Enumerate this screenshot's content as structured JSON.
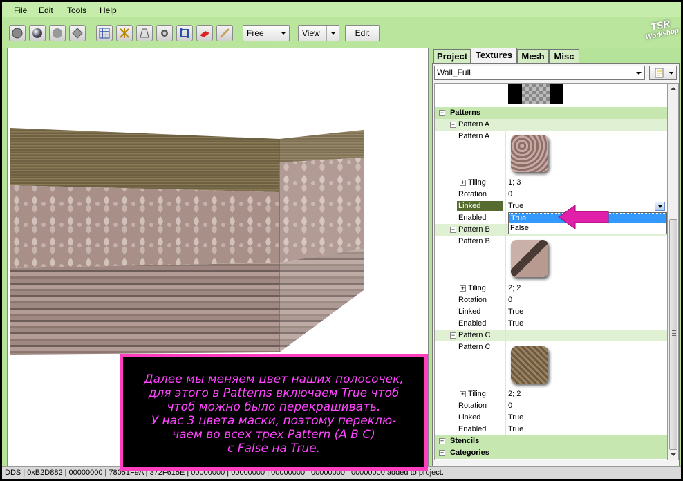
{
  "menu": [
    "File",
    "Edit",
    "Tools",
    "Help"
  ],
  "toolbar": {
    "mode_combo": "Free",
    "view_combo": "View",
    "edit_button": "Edit"
  },
  "logo": {
    "line1": "TSR",
    "line2": "Workshop"
  },
  "tabs": [
    "Project",
    "Textures",
    "Mesh",
    "Misc"
  ],
  "active_tab": "Textures",
  "texture_select": "Wall_Full",
  "properties": {
    "patterns": "Patterns",
    "pattern_a": {
      "header": "Pattern A",
      "image_label": "Pattern A",
      "tiling_label": "Tiling",
      "tiling": "1; 3",
      "rotation_label": "Rotation",
      "rotation": "0",
      "linked_label": "Linked",
      "linked": "True",
      "enabled_label": "Enabled"
    },
    "pattern_b": {
      "header": "Pattern B",
      "image_label": "Pattern B",
      "tiling_label": "Tiling",
      "tiling": "2; 2",
      "rotation_label": "Rotation",
      "rotation": "0",
      "linked_label": "Linked",
      "linked": "True",
      "enabled_label": "Enabled",
      "enabled": "True"
    },
    "pattern_c": {
      "header": "Pattern C",
      "image_label": "Pattern C",
      "tiling_label": "Tiling",
      "tiling": "2; 2",
      "rotation_label": "Rotation",
      "rotation": "0",
      "linked_label": "Linked",
      "linked": "True",
      "enabled_label": "Enabled",
      "enabled": "True"
    },
    "stencils": "Stencils",
    "categories": "Categories"
  },
  "dropdown_options": [
    "True",
    "False"
  ],
  "dropdown_selected": "True",
  "overlay_lines": [
    "Далее мы меняем цвет наших полосочек,",
    "для этого в Patterns включаем True чтоб",
    "чтоб можно было перекрашивать.",
    "У нас 3 цвета маски, поэтому переклю-",
    "чаем во всех трех Pattern (A B C)",
    "с False на True."
  ],
  "statusbar": "DDS | 0xB2D882 | 00000000 | 78051F9A | 372F615E | 00000000 | 00000000 | 00000000 | 00000000 | 00000000 added to project.",
  "colors": {
    "accent": "#b6e39a",
    "highlight": "#3399ff",
    "overlay_text": "#ff44ff",
    "overlay_border": "#ff3fbf",
    "arrow": "#e020a8"
  }
}
